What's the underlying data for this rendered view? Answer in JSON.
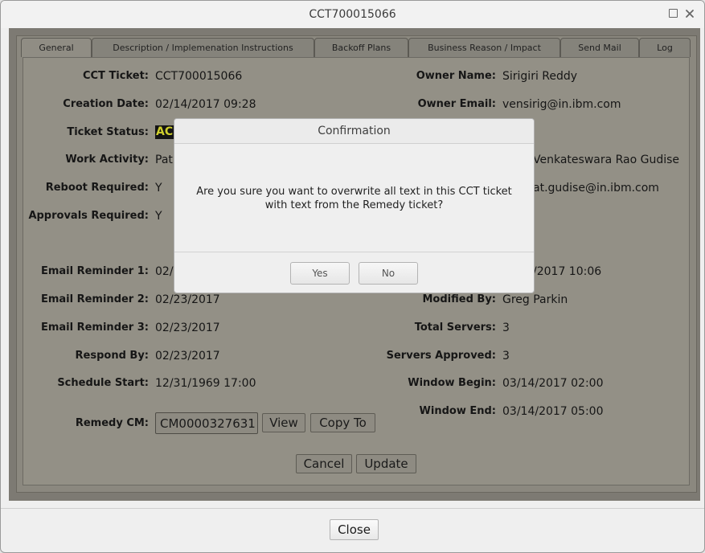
{
  "window": {
    "title": "CCT700015066"
  },
  "tabs": [
    "General",
    "Description / Implemenation Instructions",
    "Backoff Plans",
    "Business Reason / Impact",
    "Send Mail",
    "Log"
  ],
  "left": {
    "cct_ticket_label": "CCT Ticket:",
    "cct_ticket": "CCT700015066",
    "creation_date_label": "Creation Date:",
    "creation_date": "02/14/2017 09:28",
    "ticket_status_label": "Ticket Status:",
    "ticket_status": "AC",
    "work_activity_label": "Work Activity:",
    "work_activity": "Pat",
    "reboot_required_label": "Reboot Required:",
    "reboot_required": "Y",
    "approvals_required_label": "Approvals Required:",
    "approvals_required": "Y",
    "email_reminder_1_label": "Email Reminder 1:",
    "email_reminder_1": "02/",
    "email_reminder_2_label": "Email Reminder 2:",
    "email_reminder_2": "02/23/2017",
    "email_reminder_3_label": "Email Reminder 3:",
    "email_reminder_3": "02/23/2017",
    "respond_by_label": "Respond By:",
    "respond_by": "02/23/2017",
    "schedule_start_label": "Schedule Start:",
    "schedule_start": "12/31/1969 17:00",
    "remedy_cm_label": "Remedy CM:",
    "remedy_cm": "CM0000327631",
    "view_label": "View",
    "copy_to_label": "Copy To"
  },
  "right": {
    "owner_name_label": "Owner Name:",
    "owner_name": "Sirigiri Reddy",
    "owner_email_label": "Owner Email:",
    "owner_email": "vensirig@in.ibm.com",
    "partial_name": "Venkateswara Rao Gudise",
    "partial_email": "at.gudise@in.ibm.com",
    "partial_date": "/2017 10:06",
    "modified_by_label": "Modified By:",
    "modified_by": "Greg Parkin",
    "total_servers_label": "Total Servers:",
    "total_servers": "3",
    "servers_approved_label": "Servers Approved:",
    "servers_approved": "3",
    "window_begin_label": "Window Begin:",
    "window_begin": "03/14/2017 02:00",
    "window_end_label": "Window End:",
    "window_end": "03/14/2017 05:00"
  },
  "actions": {
    "cancel_label": "Cancel",
    "update_label": "Update"
  },
  "dialog": {
    "title": "Confirmation",
    "message_line1": "Are you sure you want to overwrite all text in this CCT ticket",
    "message_line2": "with text from the Remedy ticket?",
    "yes_label": "Yes",
    "no_label": "No"
  },
  "footer": {
    "close_label": "Close"
  },
  "icons": {
    "maximize": "maximize-icon",
    "close": "close-icon"
  },
  "colors": {
    "status_text": "#cfcf2e",
    "status_bg": "#141414"
  }
}
